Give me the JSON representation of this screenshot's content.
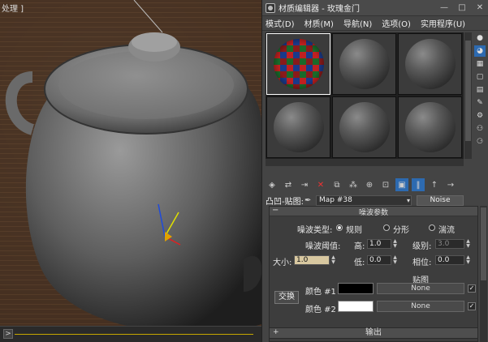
{
  "viewport": {
    "label": "处理 ]"
  },
  "window": {
    "title": "材质编辑器 - 玫瑰金门",
    "minimize": "—",
    "maximize": "□",
    "close": "✕"
  },
  "menu": [
    "模式(D)",
    "材质(M)",
    "导航(N)",
    "选项(O)",
    "实用程序(U)"
  ],
  "map": {
    "label": "凸凹-贴图:",
    "name": "Map #38",
    "type": "Noise"
  },
  "rollout": {
    "title": "噪波参数",
    "noise_type_label": "噪波类型:",
    "noise_types": [
      "规则",
      "分形",
      "湍流"
    ],
    "noise_type_selected": "规则",
    "threshold_label": "噪波阈值:",
    "high_label": "高:",
    "high_value": "1.0",
    "levels_label": "级别:",
    "levels_value": "3.0",
    "size_label": "大小:",
    "size_value": "1.0",
    "low_label": "低:",
    "low_value": "0.0",
    "phase_label": "相位:",
    "phase_value": "0.0",
    "maps_label": "贴图",
    "swap_label": "交换",
    "color1_label": "颜色 #1",
    "color1": "#000000",
    "color1_map": "None",
    "color2_label": "颜色 #2",
    "color2": "#ffffff",
    "color2_map": "None"
  },
  "output": {
    "label": "输出"
  }
}
